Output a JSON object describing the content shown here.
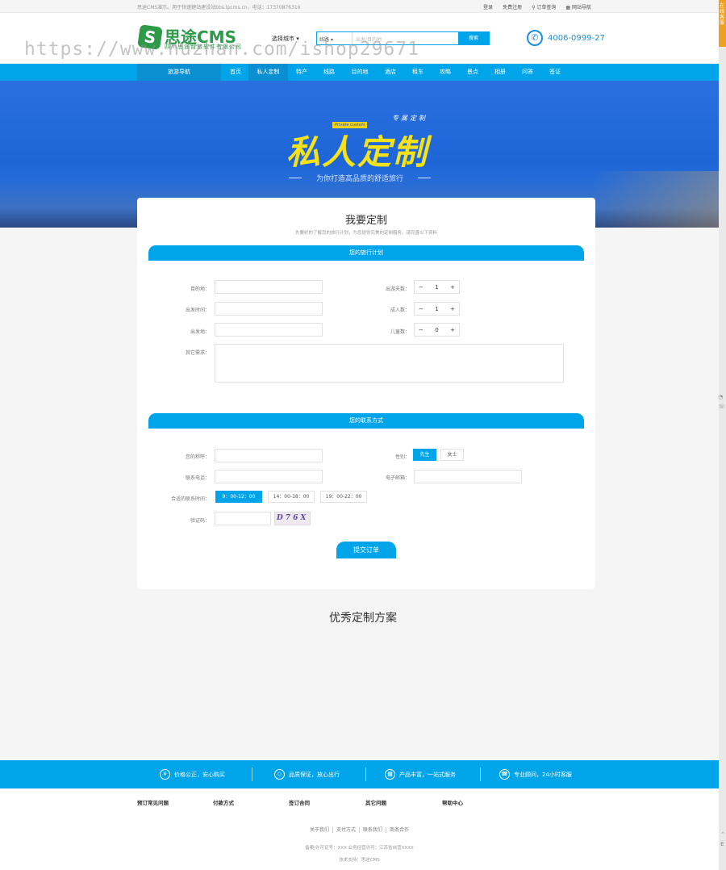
{
  "topbar": {
    "notice": "思途CMS演示。用于快速建站建设站bbs.lpcms.cn，电话：17370876316",
    "links": [
      "登录",
      "免费注册",
      "订单查询",
      "网站导航"
    ]
  },
  "header": {
    "logo_mark": "S",
    "logo_name": "思途CMS",
    "logo_sub": "四川思途智旅软件有限公司",
    "watermark": "https://www.huzhan.com/ishop29671",
    "city_label": "选择城市",
    "search_select": "线路",
    "search_placeholder": "出发/目的地",
    "search_button": "搜索",
    "phone": "4006-0999-27"
  },
  "nav": {
    "guide": "旅游导航",
    "items": [
      "首页",
      "私人定制",
      "特产",
      "线路",
      "目的地",
      "酒店",
      "租车",
      "攻略",
      "景点",
      "相册",
      "问答",
      "签证"
    ]
  },
  "banner": {
    "tag": "专属定制",
    "mini": "Private custom",
    "title": "私人定制",
    "slogan": "为你打造高品质的舒适旅行"
  },
  "form": {
    "title": "我要定制",
    "intro": "先要好的了解您的旅行计划，为您提供完美的定制服务。请完善以下资料",
    "section1": "您的旅行计划",
    "destination_label": "目的地：",
    "depart_time_label": "出发时间：",
    "depart_place_label": "出发地：",
    "days_label": "出游天数：",
    "days_value": "1",
    "adults_label": "成人数：",
    "adults_value": "1",
    "children_label": "儿童数：",
    "children_value": "0",
    "other_label": "其它需求：",
    "minus": "−",
    "plus": "+",
    "section2": "您的联系方式",
    "name_label": "您的称呼：",
    "gender_label": "性别：",
    "gender_male": "先生",
    "gender_female": "女士",
    "phone_label": "联系电话：",
    "email_label": "电子邮箱：",
    "contact_time_label": "合适的联系时间：",
    "times": [
      "9：00-12：00",
      "14：00-18：00",
      "19：00-22：00"
    ],
    "captcha_label": "验证码：",
    "captcha_text": "D76X",
    "submit": "提交订单"
  },
  "plans_title": "优秀定制方案",
  "features": [
    {
      "icon": "¥",
      "label": "价格公正，安心购买"
    },
    {
      "icon": "◇",
      "label": "品质保证，放心出行"
    },
    {
      "icon": "▦",
      "label": "产品丰富，一站式服务"
    },
    {
      "icon": "☎",
      "label": "专业顾问，24小时客服"
    }
  ],
  "footer": {
    "columns": [
      "预订常见问题",
      "付款方式",
      "签订合同",
      "其它问题",
      "帮助中心"
    ],
    "links": [
      "关于我们",
      "支付方式",
      "联系我们",
      "商务合作"
    ],
    "icp": "备案/许可证号：XXX  业务经营许可：江苏省自营XXXX",
    "powered": "技术支持：思途CMS"
  },
  "sidebar": {
    "tab": "在线客服",
    "icons": [
      "◔",
      "☏"
    ],
    "bottom_icons": [
      "⌃",
      "E"
    ]
  },
  "colors": {
    "primary": "#00a4e8",
    "dark_primary": "#0a8fd0",
    "logo_green": "#2d9a4a",
    "banner_yellow": "#f5e21a"
  }
}
